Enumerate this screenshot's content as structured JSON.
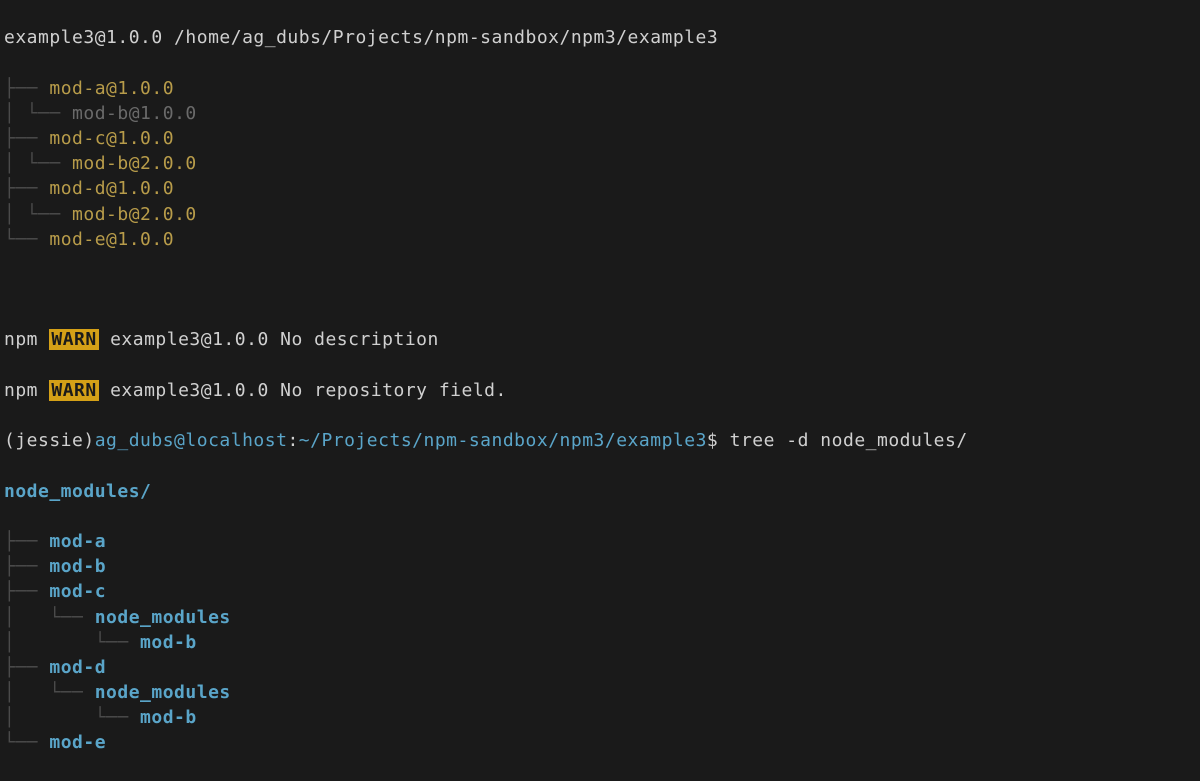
{
  "header": "example3@1.0.0 /home/ag_dubs/Projects/npm-sandbox/npm3/example3",
  "lsTree": [
    {
      "prefix": "├── ",
      "name": "mod-a@1.0.0",
      "cls": "pkg-yellow"
    },
    {
      "prefix": "│ └── ",
      "name": "mod-b@1.0.0",
      "cls": "pkg-gray"
    },
    {
      "prefix": "├── ",
      "name": "mod-c@1.0.0",
      "cls": "pkg-yellow"
    },
    {
      "prefix": "│ └── ",
      "name": "mod-b@2.0.0",
      "cls": "pkg-yellow"
    },
    {
      "prefix": "├── ",
      "name": "mod-d@1.0.0",
      "cls": "pkg-yellow"
    },
    {
      "prefix": "│ └── ",
      "name": "mod-b@2.0.0",
      "cls": "pkg-yellow"
    },
    {
      "prefix": "└── ",
      "name": "mod-e@1.0.0",
      "cls": "pkg-yellow"
    }
  ],
  "warn": {
    "npmLabel": "npm",
    "warnLabel": "WARN",
    "lines": [
      "example3@1.0.0 No description",
      "example3@1.0.0 No repository field."
    ]
  },
  "prompt": {
    "distro": "(jessie)",
    "user": "ag_dubs@localhost",
    "sep": ":",
    "path": "~/Projects/npm-sandbox/npm3/example3",
    "dollar": "$ ",
    "command": "tree -d node_modules/"
  },
  "dirRoot": "node_modules/",
  "dirTree": [
    {
      "prefix": "├── ",
      "name": "mod-a"
    },
    {
      "prefix": "├── ",
      "name": "mod-b"
    },
    {
      "prefix": "├── ",
      "name": "mod-c"
    },
    {
      "prefix": "│   └── ",
      "name": "node_modules"
    },
    {
      "prefix": "│       └── ",
      "name": "mod-b"
    },
    {
      "prefix": "├── ",
      "name": "mod-d"
    },
    {
      "prefix": "│   └── ",
      "name": "node_modules"
    },
    {
      "prefix": "│       └── ",
      "name": "mod-b"
    },
    {
      "prefix": "└── ",
      "name": "mod-e"
    }
  ]
}
